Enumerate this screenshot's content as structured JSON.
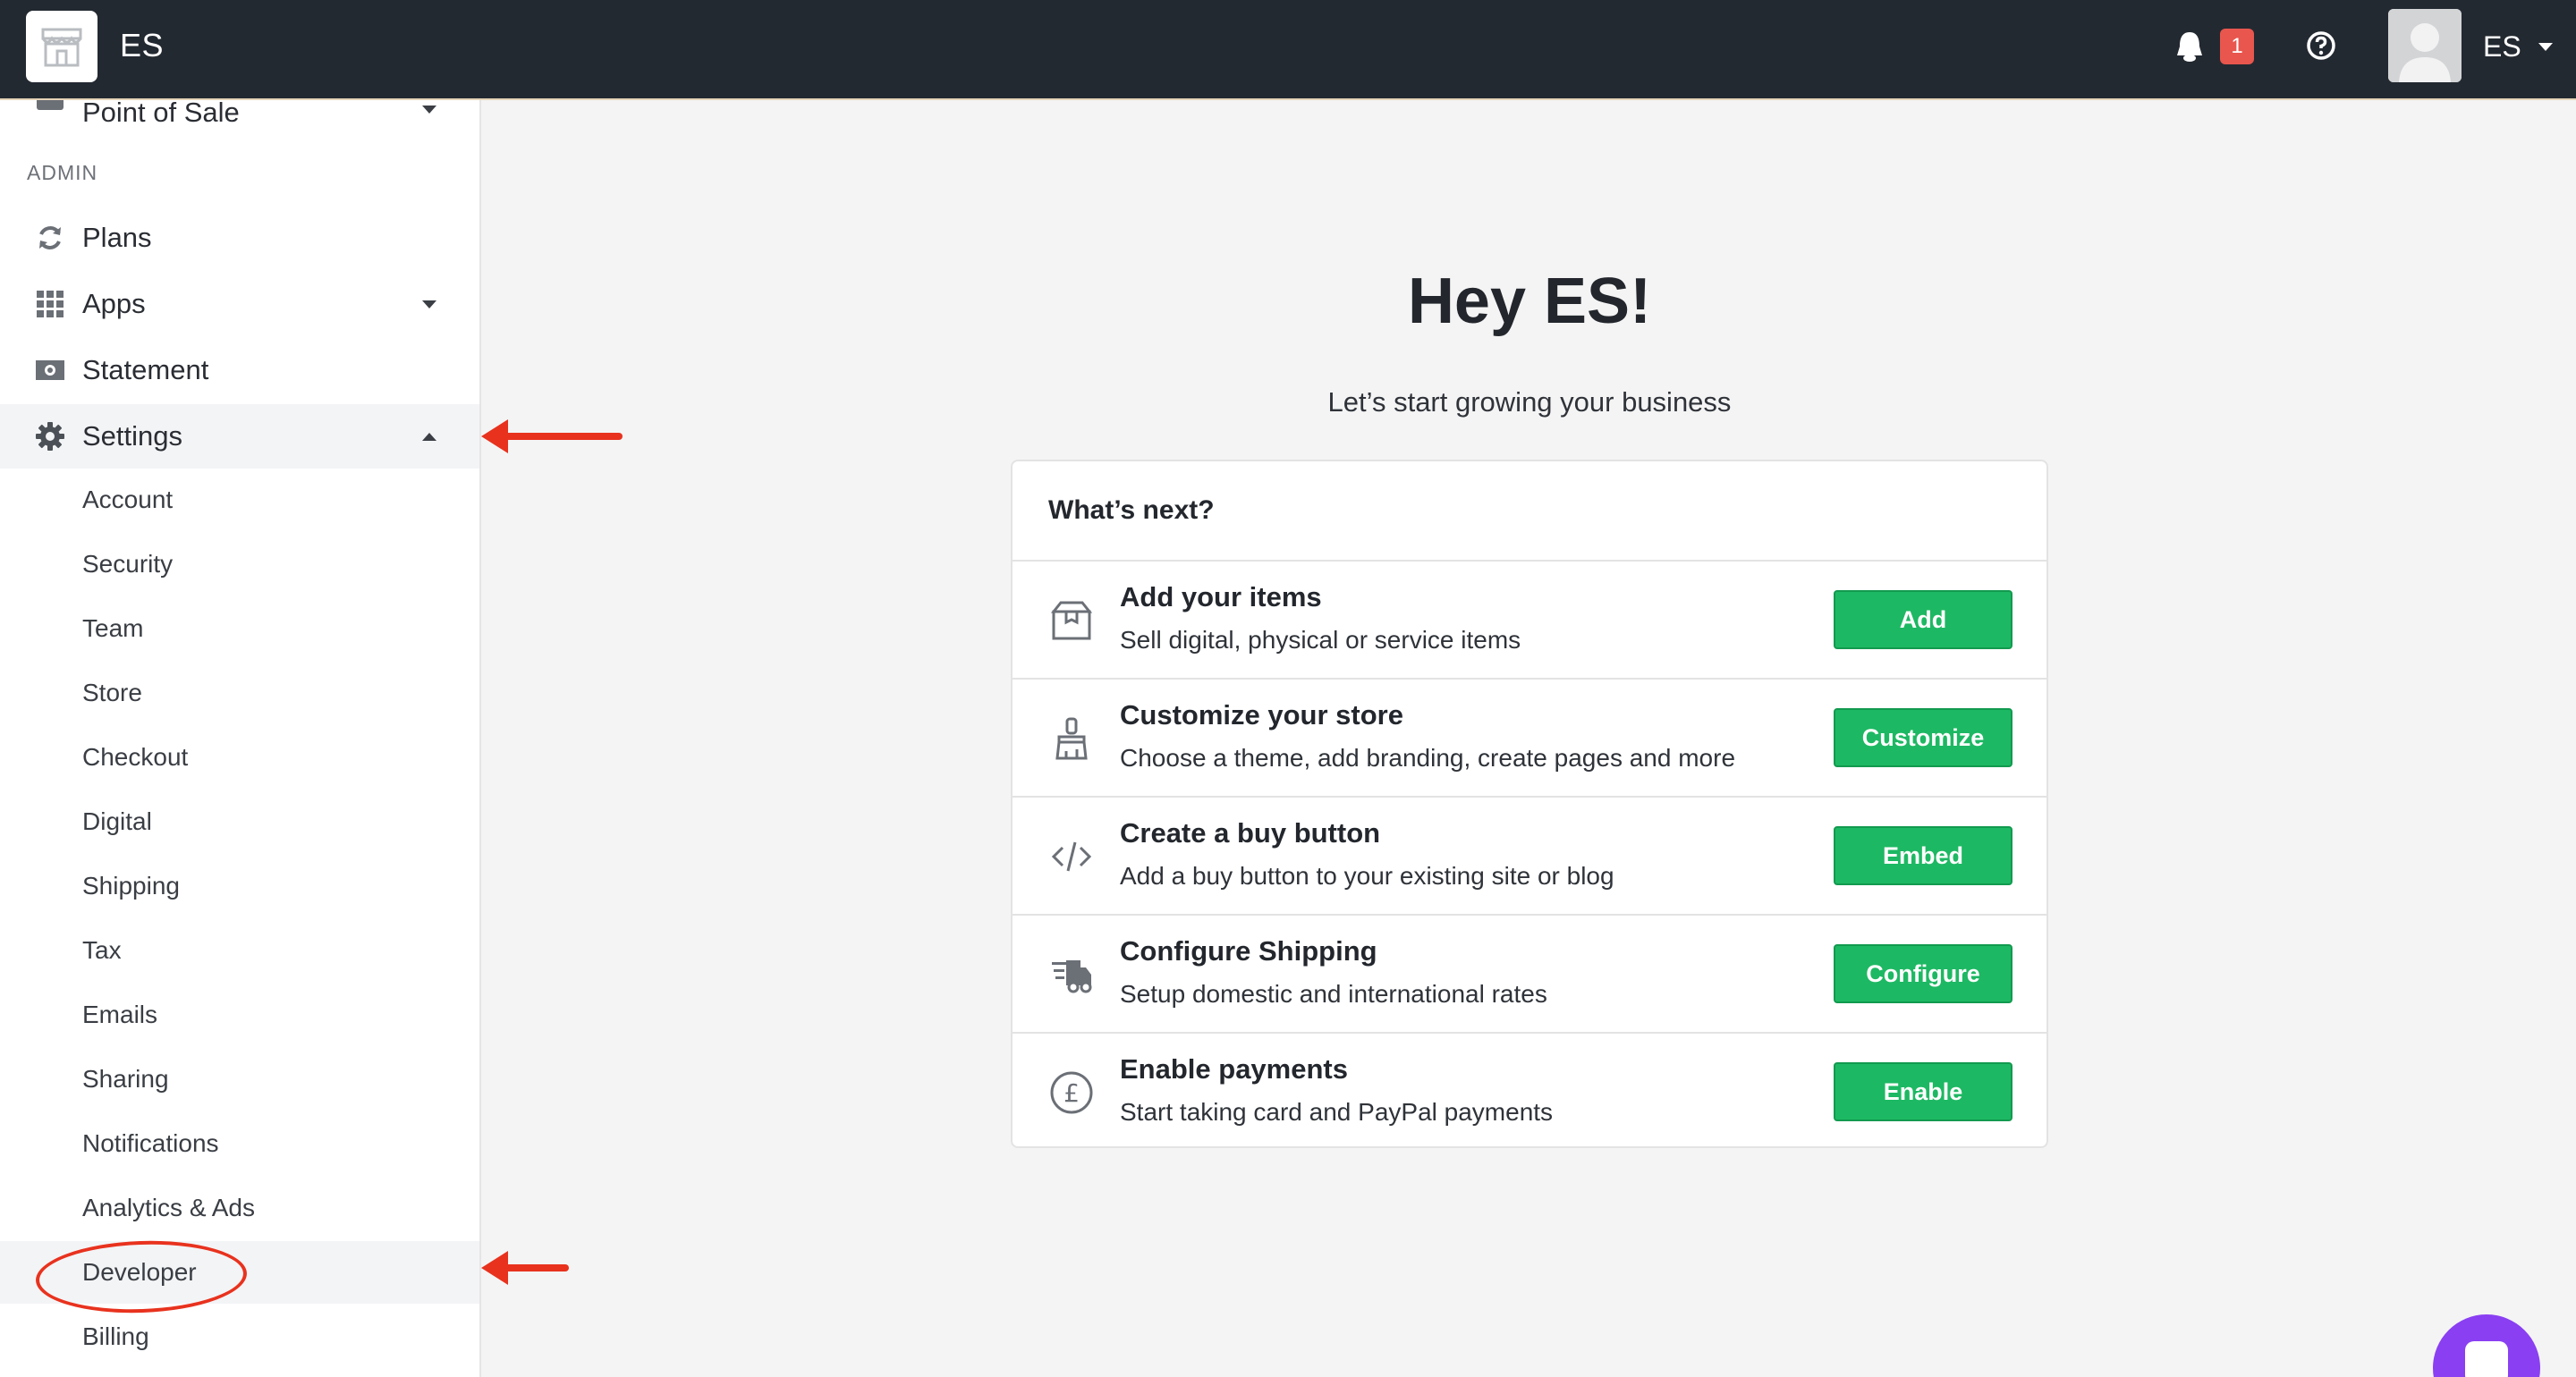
{
  "header": {
    "store_name": "ES",
    "notification_count": "1",
    "user_name": "ES"
  },
  "sidebar": {
    "partial_item": "Point of Sale",
    "section_label": "ADMIN",
    "items": [
      {
        "label": "Plans",
        "icon": "refresh-icon"
      },
      {
        "label": "Apps",
        "icon": "grid-icon"
      },
      {
        "label": "Statement",
        "icon": "money-icon"
      },
      {
        "label": "Settings",
        "icon": "gear-icon"
      }
    ],
    "settings_sub": [
      "Account",
      "Security",
      "Team",
      "Store",
      "Checkout",
      "Digital",
      "Shipping",
      "Tax",
      "Emails",
      "Sharing",
      "Notifications",
      "Analytics & Ads",
      "Developer",
      "Billing"
    ]
  },
  "main": {
    "title": "Hey ES!",
    "subtitle": "Let’s start growing your business",
    "card_title": "What’s next?",
    "tasks": [
      {
        "title": "Add your items",
        "desc": "Sell digital, physical or service items",
        "button": "Add",
        "icon": "box-icon"
      },
      {
        "title": "Customize your store",
        "desc": "Choose a theme, add branding, create pages and more",
        "button": "Customize",
        "icon": "brush-icon"
      },
      {
        "title": "Create a buy button",
        "desc": "Add a buy button to your existing site or blog",
        "button": "Embed",
        "icon": "code-icon"
      },
      {
        "title": "Configure Shipping",
        "desc": "Setup domestic and international rates",
        "button": "Configure",
        "icon": "truck-icon"
      },
      {
        "title": "Enable payments",
        "desc": "Start taking card and PayPal payments",
        "button": "Enable",
        "icon": "pound-icon"
      }
    ]
  },
  "colors": {
    "topbar": "#232931",
    "accent_green": "#1db863",
    "badge_red": "#e8564e",
    "annotation_red": "#e8321e",
    "chat_purple": "#8a3ff2"
  }
}
